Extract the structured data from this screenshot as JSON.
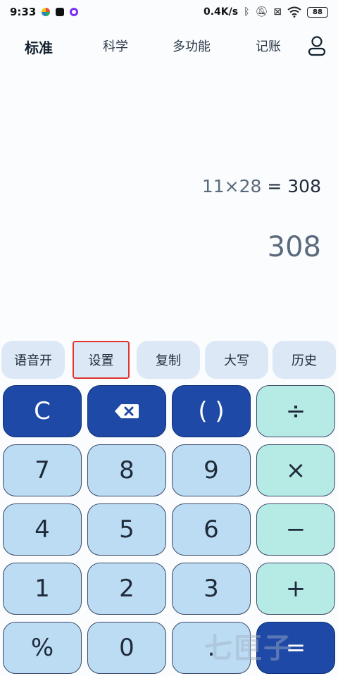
{
  "status_bar": {
    "time": "9:33",
    "net_speed": "0.4K/s",
    "battery": "88",
    "icons": [
      "bluetooth-icon",
      "mute-icon",
      "sim-icon",
      "wifi-icon"
    ]
  },
  "tabs": [
    {
      "label": "标准",
      "active": true
    },
    {
      "label": "科学"
    },
    {
      "label": "多功能"
    },
    {
      "label": "记账"
    }
  ],
  "display": {
    "expression": "11×28",
    "equals": "=",
    "expression_result": "308",
    "result": "308"
  },
  "functions": [
    "语音开",
    "设置",
    "复制",
    "大写",
    "历史"
  ],
  "keys": {
    "clear": "C",
    "paren": "( )",
    "divide": "÷",
    "seven": "7",
    "eight": "8",
    "nine": "9",
    "multiply": "×",
    "four": "4",
    "five": "5",
    "six": "6",
    "minus": "−",
    "one": "1",
    "two": "2",
    "three": "3",
    "plus": "+",
    "percent": "%",
    "zero": "0",
    "dot": ".",
    "equals": "="
  },
  "watermark": "七匣子",
  "colors": {
    "primary": "#1f49a6",
    "key_light": "#bcdcf3",
    "key_teal": "#b6ebe5",
    "pill": "#dce8f5",
    "highlight": "#e0342f"
  }
}
